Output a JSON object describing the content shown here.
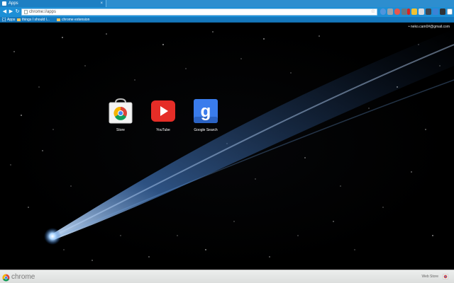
{
  "tab": {
    "title": "Apps",
    "close": "×"
  },
  "toolbar": {
    "back": "◀",
    "forward": "▶",
    "reload": "↻",
    "address": "chrome://apps",
    "star": "☆"
  },
  "bookmarks": {
    "items": [
      {
        "label": "Apps"
      },
      {
        "label": "things I should l..."
      },
      {
        "label": "chrome extension"
      }
    ]
  },
  "user": {
    "email": "• neko.cam0#@gmail.com"
  },
  "apps": [
    {
      "name": "Store"
    },
    {
      "name": "YouTube"
    },
    {
      "name": "Google Search"
    }
  ],
  "bottom": {
    "brand": "chrome",
    "webstore": "Web Store"
  },
  "colors": {
    "tab_bar": "#2d8ecf",
    "toolbar": "#1d8fd6",
    "bookmarks_bar": "#1578bd",
    "youtube_red": "#e52d27",
    "google_blue": "#3a7cec"
  }
}
